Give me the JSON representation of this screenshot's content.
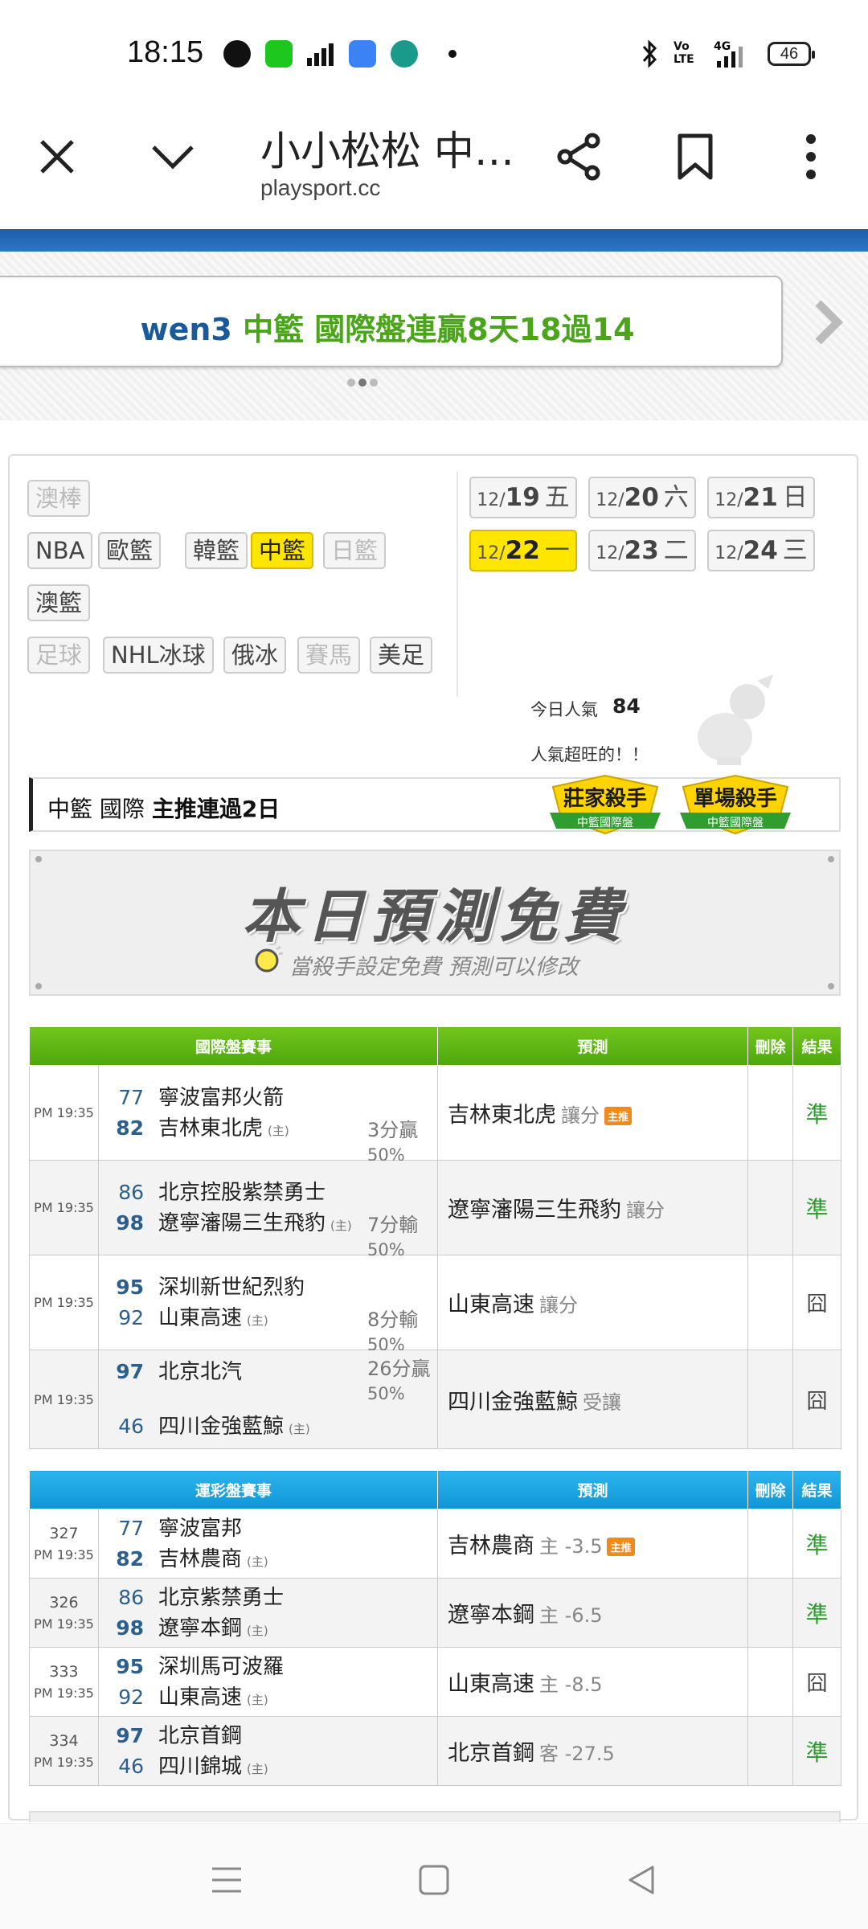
{
  "status_bar": {
    "time": "18:15",
    "battery": "46"
  },
  "browser": {
    "title": "小小松松 中…",
    "domain": "playsport.cc"
  },
  "banner": {
    "user": "wen3",
    "text": " 中籃 國際盤連贏8天18過14"
  },
  "sports": [
    {
      "label": "澳棒",
      "disabled": true
    },
    {
      "label": "NBA",
      "disabled": false
    },
    {
      "label": "歐籃",
      "disabled": false
    },
    {
      "label": "韓籃",
      "disabled": false
    },
    {
      "label": "中籃",
      "disabled": false,
      "active": true
    },
    {
      "label": "日籃",
      "disabled": true
    },
    {
      "label": "澳籃",
      "disabled": false
    },
    {
      "label": "足球",
      "disabled": true
    },
    {
      "label": "NHL冰球",
      "disabled": false
    },
    {
      "label": "俄冰",
      "disabled": false
    },
    {
      "label": "賽馬",
      "disabled": true
    },
    {
      "label": "美足",
      "disabled": false
    }
  ],
  "dates": [
    {
      "month": "12/",
      "day": "19",
      "weekday": "五"
    },
    {
      "month": "12/",
      "day": "20",
      "weekday": "六"
    },
    {
      "month": "12/",
      "day": "21",
      "weekday": "日"
    },
    {
      "month": "12/",
      "day": "22",
      "weekday": "一",
      "active": true
    },
    {
      "month": "12/",
      "day": "23",
      "weekday": "二"
    },
    {
      "month": "12/",
      "day": "24",
      "weekday": "三"
    }
  ],
  "popularity": {
    "label": "今日人氣",
    "value": "84",
    "message": "人氣超旺的！！"
  },
  "streak": {
    "prefix": "中籃 國際 ",
    "bold": "主推連過2日"
  },
  "badges": [
    {
      "title": "莊家殺手",
      "sub": "中籃國際盤"
    },
    {
      "title": "單場殺手",
      "sub": "中籃國際盤"
    }
  ],
  "free_banner": {
    "title": "本日預測免費",
    "subtitle": "當殺手設定免費  預測可以修改"
  },
  "intl_table": {
    "headers": [
      "國際盤賽事",
      "預測",
      "刪除",
      "結果"
    ],
    "rows": [
      {
        "time": "PM 19:35",
        "away_score": "77",
        "away": "寧波富邦火箭",
        "home_score": "82",
        "home": "吉林東北虎",
        "home_tag": "(主)",
        "margin": "3分贏",
        "pct": "50%",
        "pick": "吉林東北虎",
        "note": "讓分",
        "tag": "主推",
        "result": "準",
        "win": true,
        "alt": false,
        "home_wins": true
      },
      {
        "time": "PM 19:35",
        "away_score": "86",
        "away": "北京控股紫禁勇士",
        "home_score": "98",
        "home": "遼寧瀋陽三生飛豹",
        "home_tag": "(主)",
        "margin": "7分輸",
        "pct": "50%",
        "pick": "遼寧瀋陽三生飛豹",
        "note": "讓分",
        "tag": "",
        "result": "準",
        "win": true,
        "alt": true,
        "home_wins": true
      },
      {
        "time": "PM 19:35",
        "away_score": "95",
        "away": "深圳新世紀烈豹",
        "home_score": "92",
        "home": "山東高速",
        "home_tag": "(主)",
        "margin": "8分輸",
        "pct": "50%",
        "pick": "山東高速",
        "note": "讓分",
        "tag": "",
        "result": "囧",
        "win": false,
        "alt": false,
        "home_wins": false
      },
      {
        "time": "PM 19:35",
        "away_score": "97",
        "away": "北京北汽",
        "home_score": "46",
        "home": "四川金強藍鯨",
        "home_tag": "(主)",
        "margin": "26分贏",
        "pct": "50%",
        "pick": "四川金強藍鯨",
        "note": "受讓",
        "tag": "",
        "result": "囧",
        "win": false,
        "alt": true,
        "home_wins": false
      }
    ]
  },
  "lott_table": {
    "headers": [
      "運彩盤賽事",
      "預測",
      "刪除",
      "結果"
    ],
    "rows": [
      {
        "num": "327",
        "time": "PM 19:35",
        "away_score": "77",
        "away": "寧波富邦",
        "home_score": "82",
        "home": "吉林農商",
        "home_tag": "(主)",
        "pick": "吉林農商",
        "note": "主 -3.5",
        "tag": "主推",
        "result": "準",
        "win": true,
        "alt": false,
        "home_wins": true
      },
      {
        "num": "326",
        "time": "PM 19:35",
        "away_score": "86",
        "away": "北京紫禁勇士",
        "home_score": "98",
        "home": "遼寧本鋼",
        "home_tag": "(主)",
        "pick": "遼寧本鋼",
        "note": "主 -6.5",
        "tag": "",
        "result": "準",
        "win": true,
        "alt": true,
        "home_wins": true
      },
      {
        "num": "333",
        "time": "PM 19:35",
        "away_score": "95",
        "away": "深圳馬可波羅",
        "home_score": "92",
        "home": "山東高速",
        "home_tag": "(主)",
        "pick": "山東高速",
        "note": "主 -8.5",
        "tag": "",
        "result": "囧",
        "win": false,
        "alt": false,
        "home_wins": false
      },
      {
        "num": "334",
        "time": "PM 19:35",
        "away_score": "97",
        "away": "北京首鋼",
        "home_score": "46",
        "home": "四川錦城",
        "home_tag": "(主)",
        "pick": "北京首鋼",
        "note": "客 -27.5",
        "tag": "",
        "result": "準",
        "win": true,
        "alt": true,
        "home_wins": false
      }
    ]
  },
  "colors": {
    "accent_blue": "#1f5fa8",
    "green_header": "#5cb614",
    "blue_header": "#1aa2e0",
    "active_yellow": "#ffe600",
    "win_green": "#2e9a2e"
  }
}
